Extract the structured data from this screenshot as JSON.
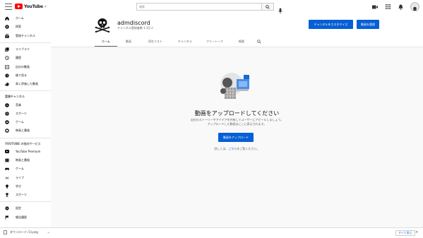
{
  "topbar": {
    "logo_text": "YouTube",
    "logo_region": "JP",
    "search_placeholder": "検索"
  },
  "sidebar": {
    "main_items": [
      {
        "label": "ホーム",
        "icon": "home-icon"
      },
      {
        "label": "探索",
        "icon": "explore-icon"
      },
      {
        "label": "登録チャンネル",
        "icon": "subscriptions-icon"
      }
    ],
    "library_items": [
      {
        "label": "ライブラリ",
        "icon": "library-icon"
      },
      {
        "label": "履歴",
        "icon": "history-icon"
      },
      {
        "label": "自分の動画",
        "icon": "my-videos-icon"
      },
      {
        "label": "後で見る",
        "icon": "watch-later-icon"
      },
      {
        "label": "高く評価した動画",
        "icon": "liked-icon"
      }
    ],
    "subscriptions_heading": "登録チャンネル",
    "subscription_items": [
      {
        "label": "音楽",
        "icon": "music-icon"
      },
      {
        "label": "スポーツ",
        "icon": "sports-icon"
      },
      {
        "label": "ゲーム",
        "icon": "gaming-icon"
      },
      {
        "label": "映画と番組",
        "icon": "movies-icon"
      }
    ],
    "more_heading": "YOUTUBE の他のサービス",
    "more_items": [
      {
        "label": "YouTube Premium",
        "icon": "premium-icon"
      },
      {
        "label": "映画と番組",
        "icon": "movies-icon"
      },
      {
        "label": "ゲーム",
        "icon": "gaming-icon"
      },
      {
        "label": "ライブ",
        "icon": "live-icon"
      },
      {
        "label": "学び",
        "icon": "learning-icon"
      },
      {
        "label": "スポーツ",
        "icon": "sports-icon"
      }
    ],
    "settings_items": [
      {
        "label": "設定",
        "icon": "settings-icon"
      },
      {
        "label": "報告履歴",
        "icon": "flag-icon"
      }
    ]
  },
  "channel": {
    "name": "admdiscord",
    "subscribers": "チャンネル登録者数 1.3万人",
    "customize_label": "チャンネルをカスタマイズ",
    "manage_label": "動画を管理",
    "tabs": [
      {
        "label": "ホーム",
        "active": true
      },
      {
        "label": "動画",
        "active": false
      },
      {
        "label": "再生リスト",
        "active": false
      },
      {
        "label": "チャンネル",
        "active": false
      },
      {
        "label": "フリートーク",
        "active": false
      },
      {
        "label": "概要",
        "active": false
      }
    ]
  },
  "empty_state": {
    "title": "動画をアップロードしてください",
    "desc_line1": "自分のストーリーやアイデアを共有してユーザーにアピールしましょう。",
    "desc_line2": "アップロードした動画はここに表示されます。",
    "upload_label": "動画をアップロード",
    "help_prefix": "詳しくは、",
    "help_link": "こちら",
    "help_suffix": "をご覧ください。"
  },
  "download_bar": {
    "filename": "ダウンロード (1).png",
    "show_all": "すべて表示"
  },
  "colors": {
    "accent": "#065fd4",
    "brand": "#ff0000"
  }
}
